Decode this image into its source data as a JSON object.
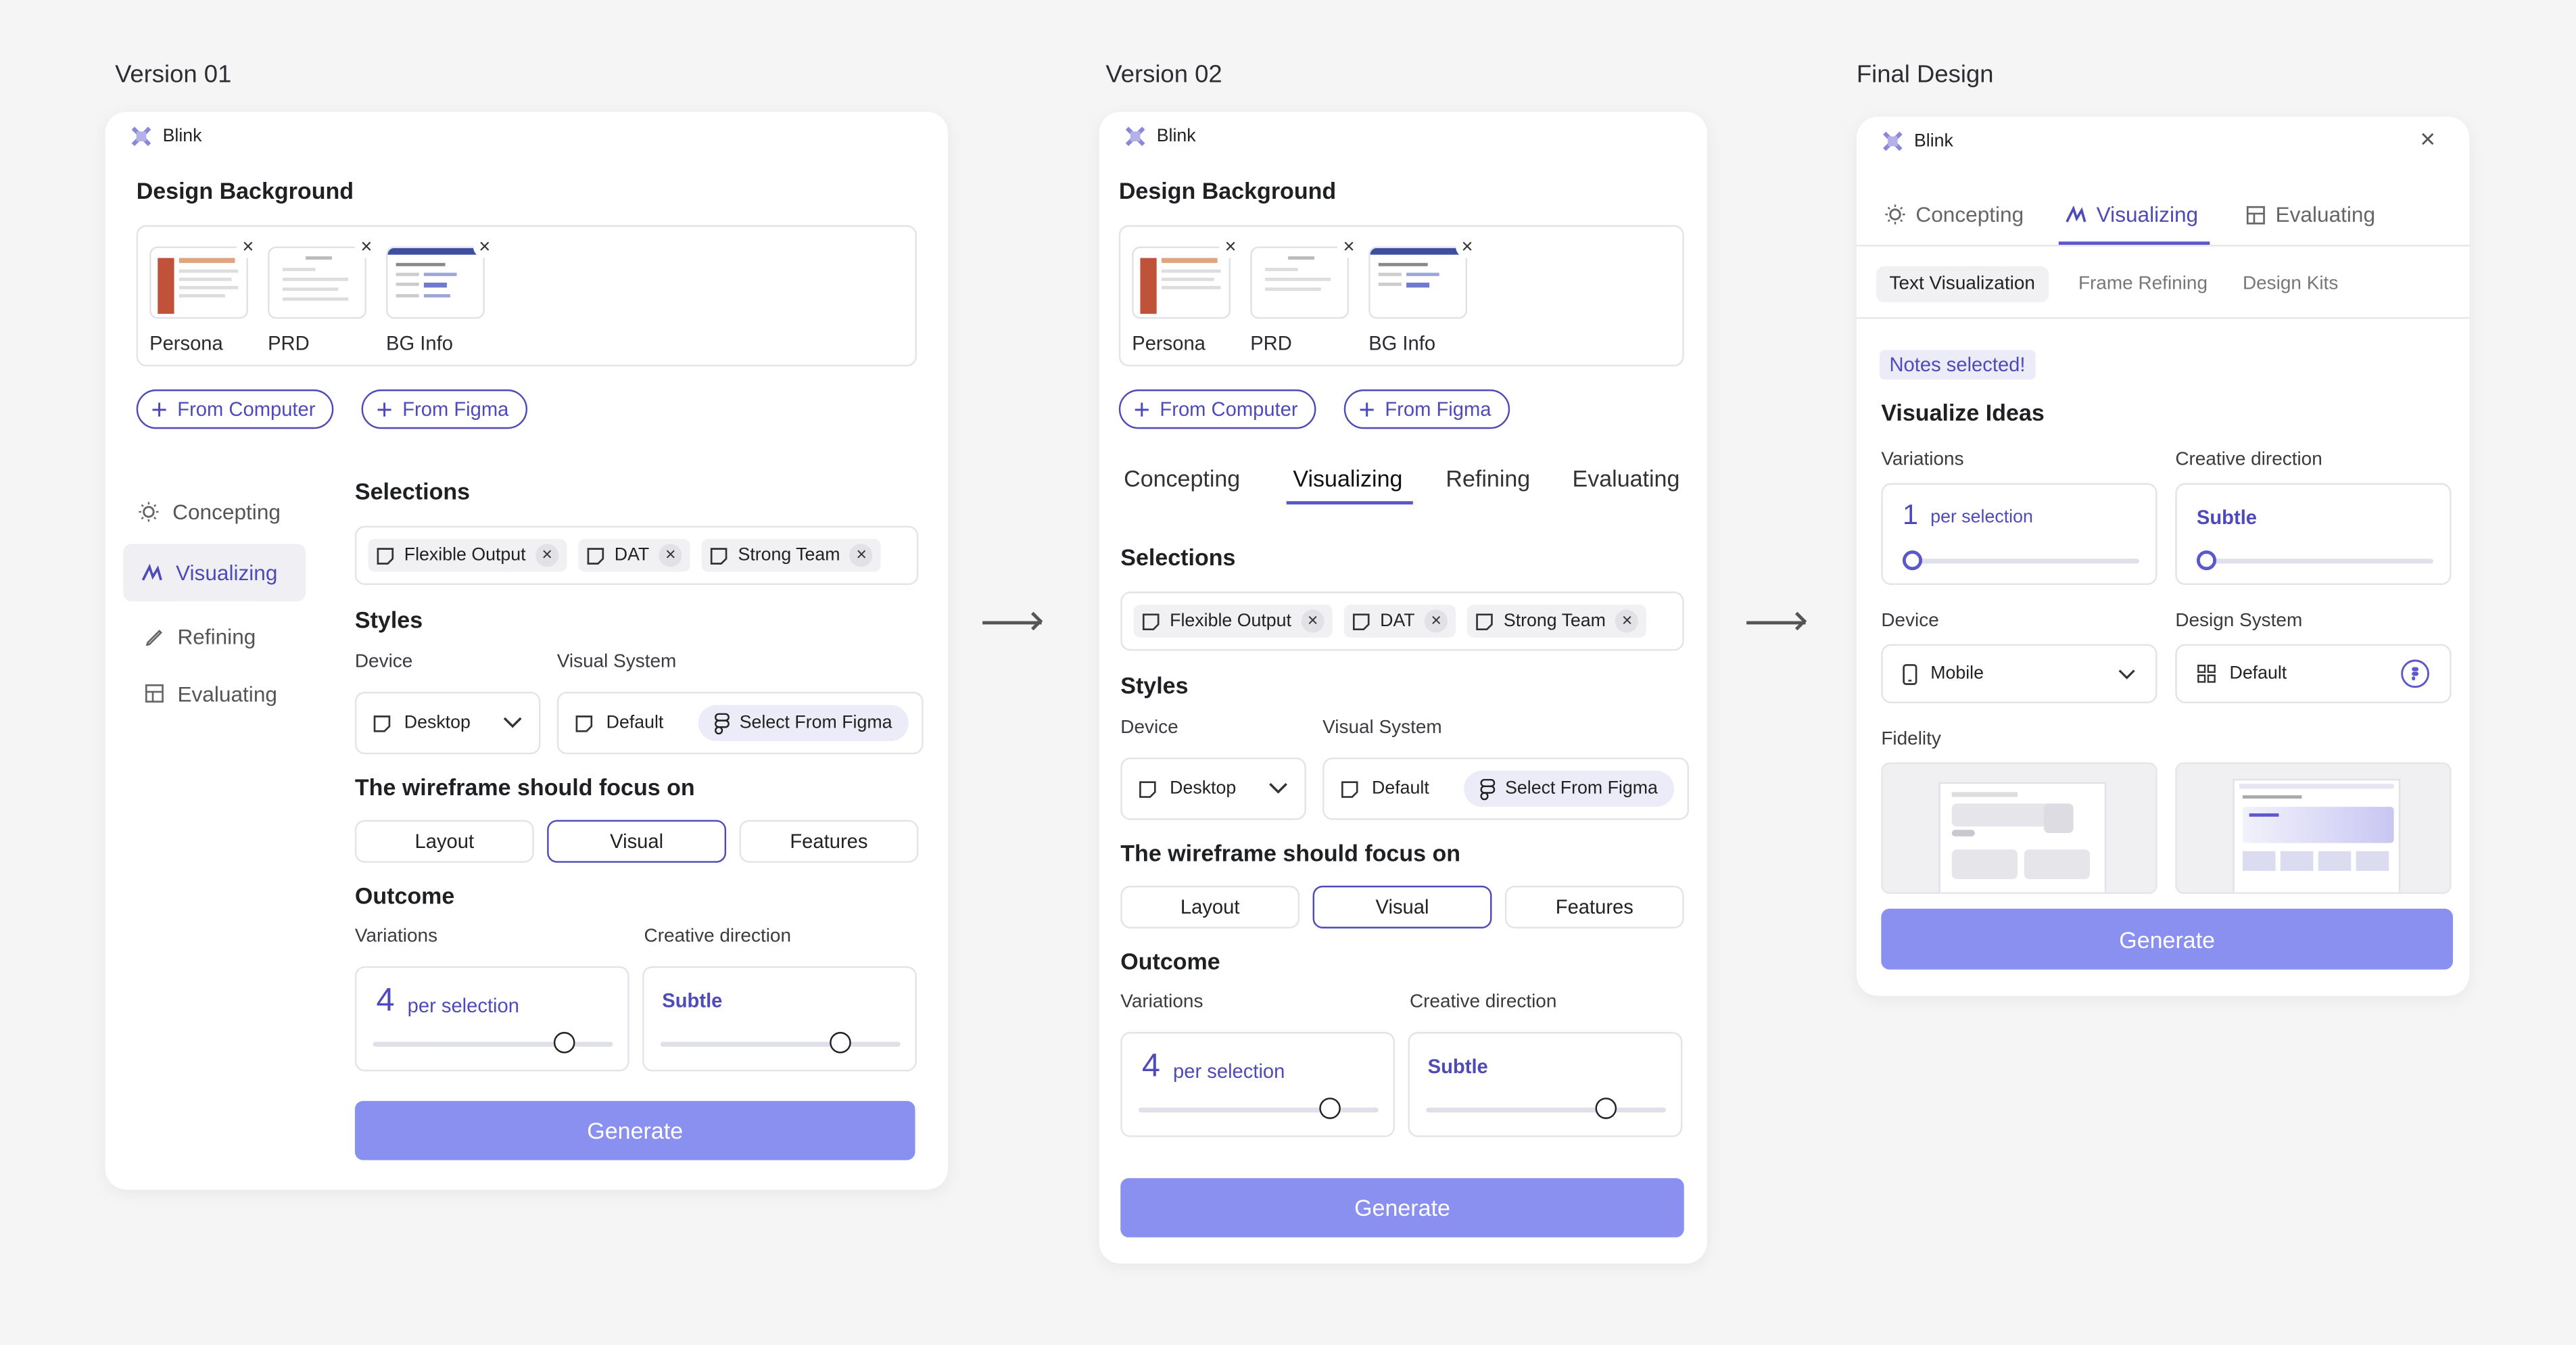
{
  "titles": {
    "v1": "Version 01",
    "v2": "Version 02",
    "v3": "Final Design"
  },
  "brand": "Blink",
  "design_background": {
    "heading": "Design Background",
    "files": [
      {
        "caption": "Persona"
      },
      {
        "caption": "PRD"
      },
      {
        "caption": "BG Info"
      }
    ],
    "from_computer": "From Computer",
    "from_figma": "From Figma"
  },
  "sidebar_items": [
    "Concepting",
    "Visualizing",
    "Refining",
    "Evaluating"
  ],
  "v2_tabs": [
    "Concepting",
    "Visualizing",
    "Refining",
    "Evaluating"
  ],
  "selections": {
    "heading": "Selections",
    "chips": [
      "Flexible Output",
      "DAT",
      "Strong Team"
    ]
  },
  "styles": {
    "heading": "Styles",
    "device_label": "Device",
    "device_value": "Desktop",
    "visual_system_label": "Visual System",
    "visual_system_value": "Default",
    "select_figma": "Select From Figma"
  },
  "focus": {
    "heading": "The wireframe should focus on",
    "options": [
      "Layout",
      "Visual",
      "Features"
    ],
    "selected": "Visual"
  },
  "outcome": {
    "heading": "Outcome",
    "variations_label": "Variations",
    "variations_value": "4",
    "per_selection": "per selection",
    "creative_label": "Creative direction",
    "creative_value": "Subtle",
    "variations_fraction": 0.8,
    "creative_fraction": 0.75
  },
  "generate": "Generate",
  "final": {
    "tabs": [
      "Concepting",
      "Visualizing",
      "Evaluating"
    ],
    "subtabs": [
      "Text Visualization",
      "Frame Refining",
      "Design Kits"
    ],
    "notes_badge": "Notes selected!",
    "heading": "Visualize Ideas",
    "variations_label": "Variations",
    "variations_value": "1",
    "per_selection": "per selection",
    "creative_label": "Creative direction",
    "creative_value": "Subtle",
    "device_label": "Device",
    "device_value": "Mobile",
    "design_system_label": "Design System",
    "design_system_value": "Default",
    "fidelity_label": "Fidelity",
    "generate": "Generate"
  },
  "colors": {
    "accent": "#4e4ab8",
    "generate": "#8a90f0",
    "chip_bg": "#f1f1f4"
  }
}
